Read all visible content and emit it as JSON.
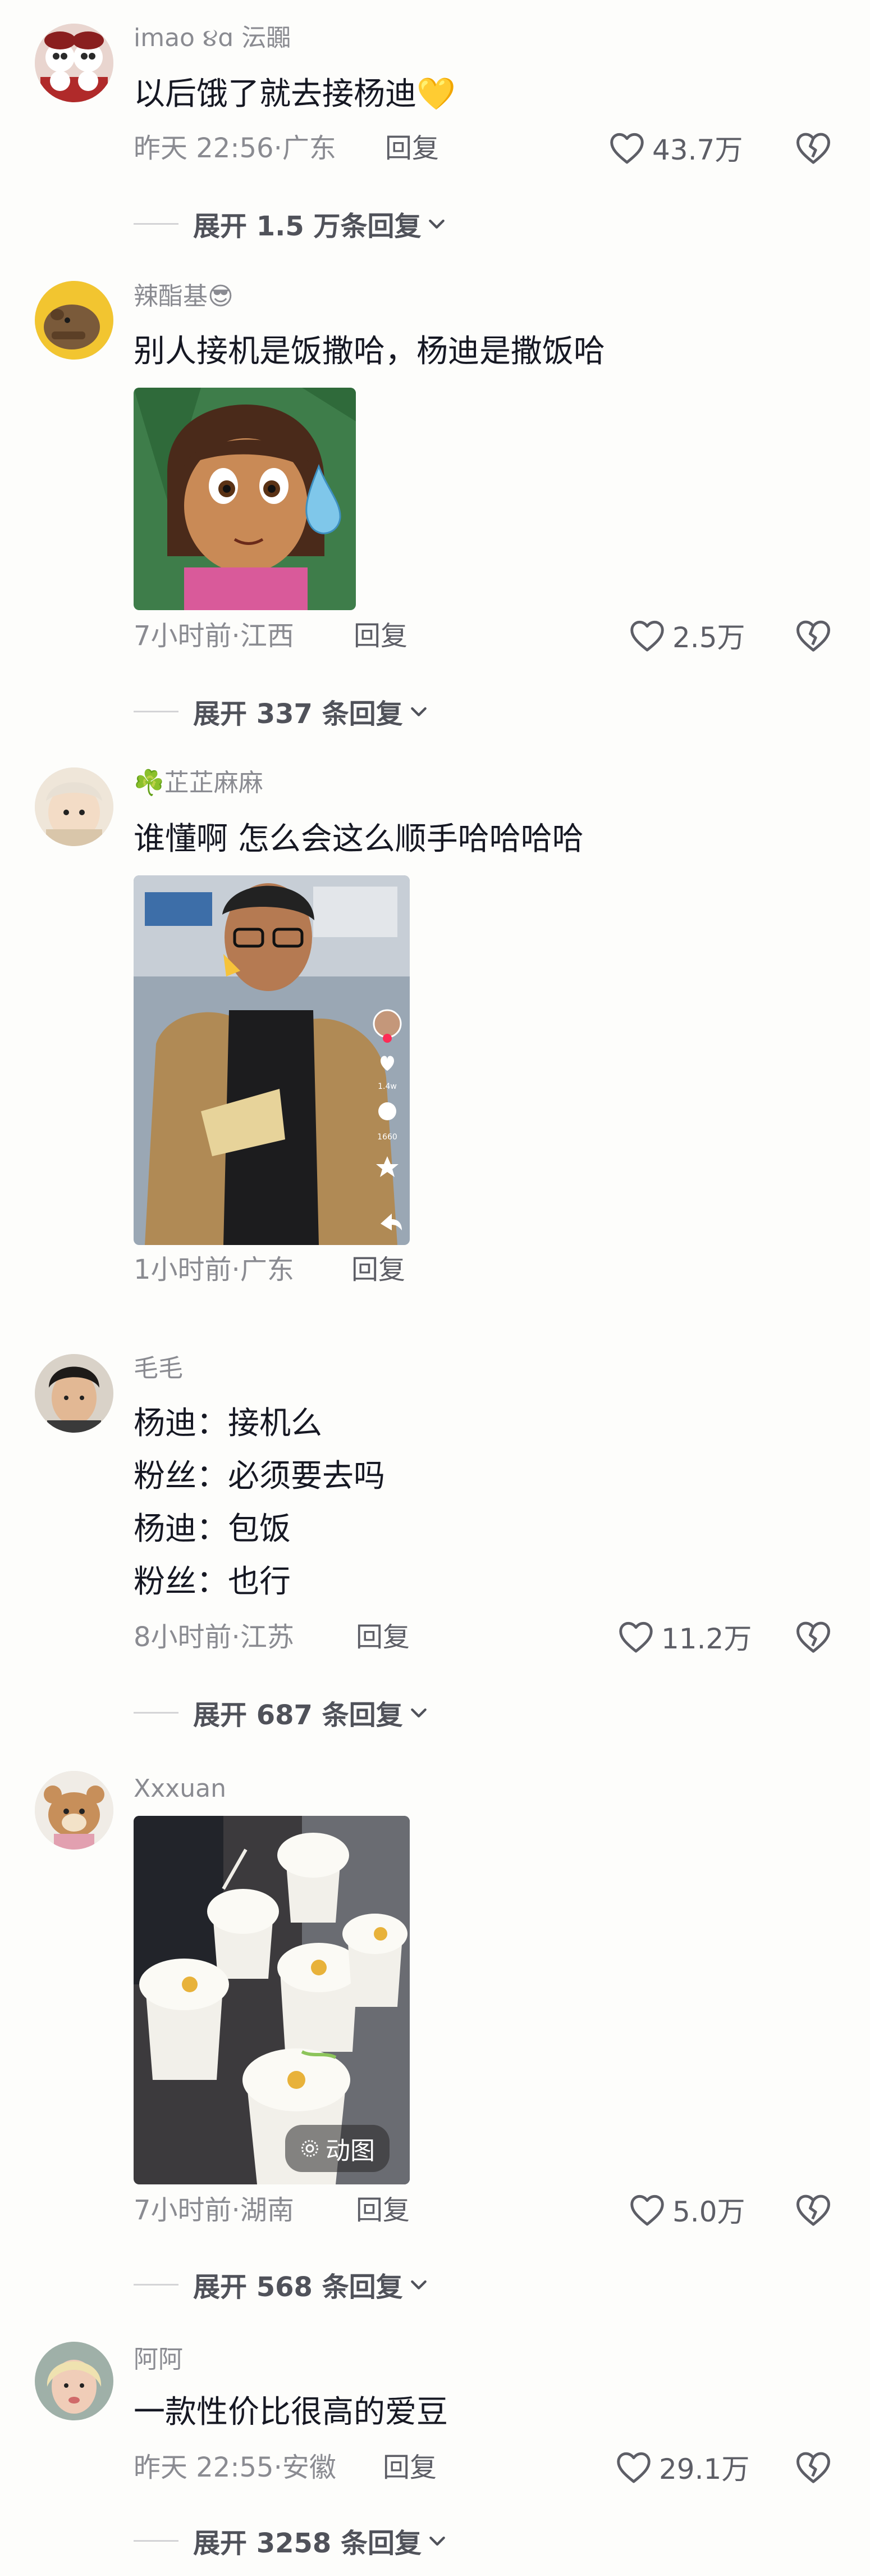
{
  "comments": [
    {
      "username": "imao ૪ɑ 沄嚻",
      "text": "以后饿了就去接杨迪",
      "emoji": "💛",
      "time": "昨天 22:56",
      "location": "广东",
      "reply_label": "回复",
      "likes": "43.7万",
      "expand_label": "展开 1.5 万条回复"
    },
    {
      "username": "辣酯基",
      "username_emoji": "😎",
      "text": "别人接机是饭撒哈，杨迪是撒饭哈",
      "time": "7小时前",
      "location": "江西",
      "reply_label": "回复",
      "likes": "2.5万",
      "expand_label": "展开 337 条回复"
    },
    {
      "username": "芷芷麻麻",
      "username_prefix": "☘️",
      "text": "谁懂啊 怎么会这么顺手哈哈哈哈",
      "time": "1小时前",
      "location": "广东",
      "reply_label": "回复",
      "video_counts": [
        "1.4w",
        "1660"
      ]
    },
    {
      "username": "毛毛",
      "lines": [
        "杨迪：接机么",
        "粉丝：必须要去吗",
        "杨迪：包饭",
        "粉丝：也行"
      ],
      "time": "8小时前",
      "location": "江苏",
      "reply_label": "回复",
      "likes": "11.2万",
      "expand_label": "展开 687 条回复"
    },
    {
      "username": "Xxxuan",
      "media_badge": "动图",
      "time": "7小时前",
      "location": "湖南",
      "reply_label": "回复",
      "likes": "5.0万",
      "expand_label": "展开 568 条回复"
    },
    {
      "username": "阿阿",
      "text": "一款性价比很高的爱豆",
      "time": "昨天 22:55",
      "location": "安徽",
      "reply_label": "回复",
      "likes": "29.1万",
      "expand_label": "展开 3258 条回复"
    }
  ],
  "separator": "·",
  "icons": {
    "like": "heart-outline-icon",
    "dislike": "broken-heart-icon",
    "expand": "chevron-down-icon",
    "badge": "live-photo-icon"
  },
  "colors": {
    "background": "#fdfdfb",
    "text": "#161823",
    "secondary": "#8a8b91",
    "action": "#5d5e66"
  }
}
